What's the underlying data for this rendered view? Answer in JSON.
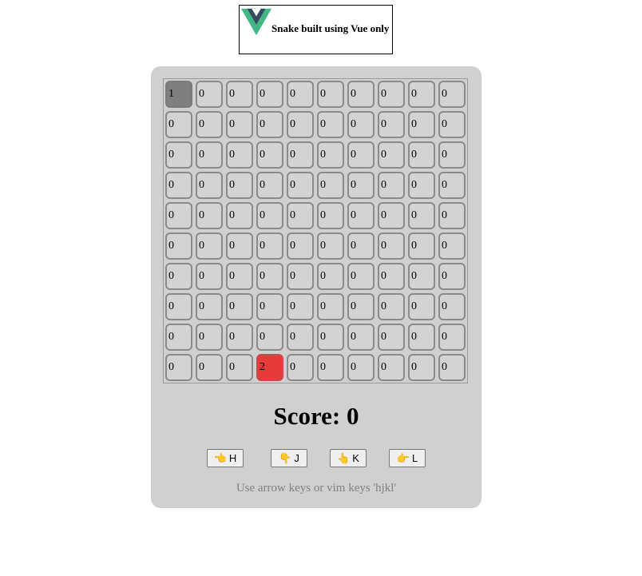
{
  "header": {
    "title": "Snake built using Vue only",
    "logo_icon": "vue-logo-icon",
    "logo_colors": {
      "outer": "#41b883",
      "inner": "#35495e"
    }
  },
  "board": {
    "rows": [
      [
        "1",
        "0",
        "0",
        "0",
        "0",
        "0",
        "0",
        "0",
        "0",
        "0"
      ],
      [
        "0",
        "0",
        "0",
        "0",
        "0",
        "0",
        "0",
        "0",
        "0",
        "0"
      ],
      [
        "0",
        "0",
        "0",
        "0",
        "0",
        "0",
        "0",
        "0",
        "0",
        "0"
      ],
      [
        "0",
        "0",
        "0",
        "0",
        "0",
        "0",
        "0",
        "0",
        "0",
        "0"
      ],
      [
        "0",
        "0",
        "0",
        "0",
        "0",
        "0",
        "0",
        "0",
        "0",
        "0"
      ],
      [
        "0",
        "0",
        "0",
        "0",
        "0",
        "0",
        "0",
        "0",
        "0",
        "0"
      ],
      [
        "0",
        "0",
        "0",
        "0",
        "0",
        "0",
        "0",
        "0",
        "0",
        "0"
      ],
      [
        "0",
        "0",
        "0",
        "0",
        "0",
        "0",
        "0",
        "0",
        "0",
        "0"
      ],
      [
        "0",
        "0",
        "0",
        "0",
        "0",
        "0",
        "0",
        "0",
        "0",
        "0"
      ],
      [
        "0",
        "0",
        "0",
        "2",
        "0",
        "0",
        "0",
        "0",
        "0",
        "0"
      ]
    ],
    "colors": {
      "empty": "#d3d3d3",
      "snake": "#7f7f7f",
      "food": "#e63b3b"
    }
  },
  "score": {
    "label": "Score: 0"
  },
  "controls": [
    {
      "label": "H",
      "icon": "hand-left-icon",
      "glyph": "👈"
    },
    {
      "label": "J",
      "icon": "hand-down-icon",
      "glyph": "👇"
    },
    {
      "label": "K",
      "icon": "hand-up-icon",
      "glyph": "👆"
    },
    {
      "label": "L",
      "icon": "hand-right-icon",
      "glyph": "👉"
    }
  ],
  "hint": "Use arrow keys or vim keys 'hjkl'"
}
